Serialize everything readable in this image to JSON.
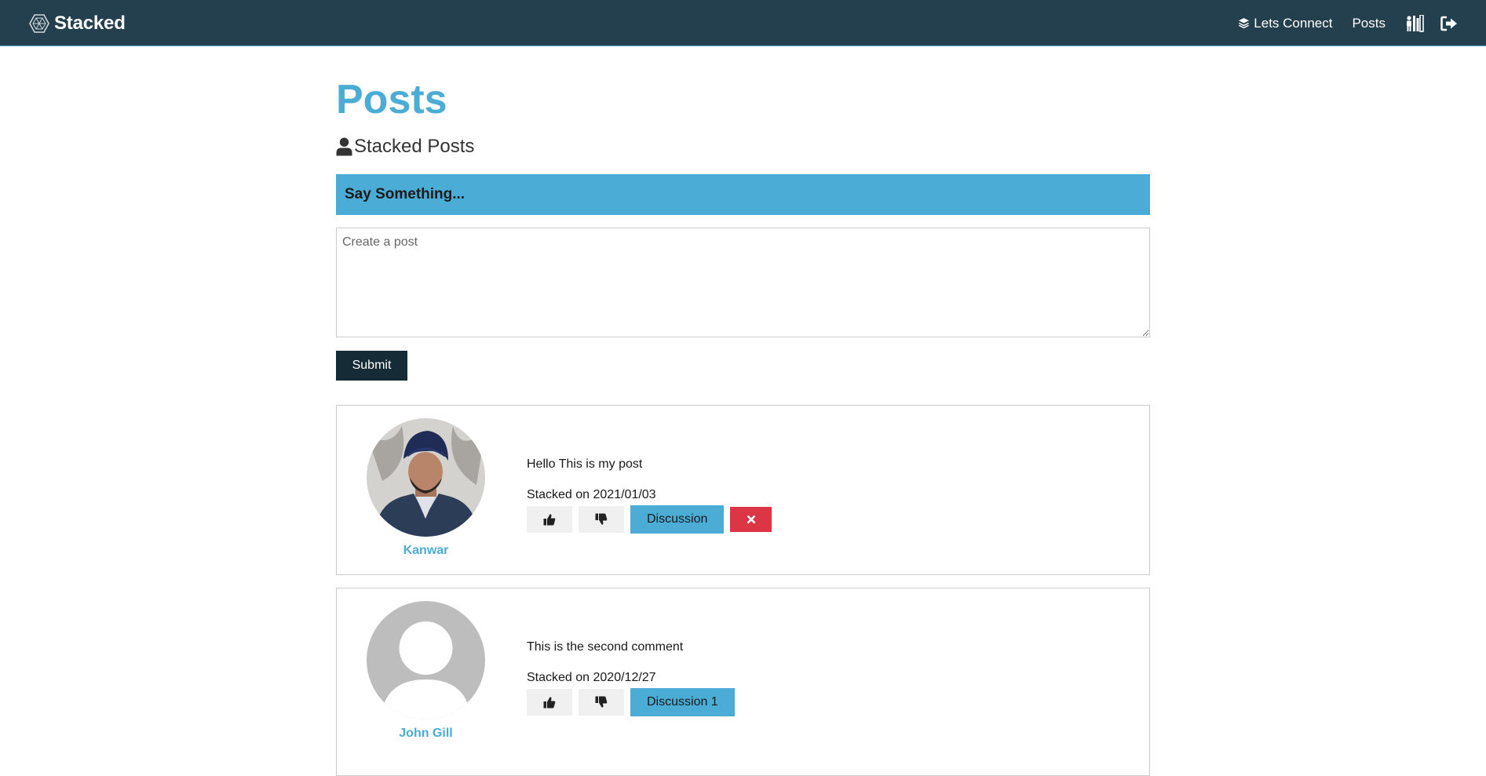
{
  "navbar": {
    "brand": "Stacked",
    "links": {
      "connect": "Lets Connect",
      "posts": "Posts"
    },
    "icons": {
      "brand": "hexagon-logo-icon",
      "connect": "layers-icon",
      "dashboard": "dashboard-icon",
      "logout": "sign-out-icon"
    },
    "color": "#243f4d"
  },
  "page": {
    "title": "Posts",
    "subtitle": "Stacked Posts",
    "subtitle_icon": "user-icon",
    "form_header": "Say Something...",
    "textarea_placeholder": "Create a post",
    "submit_label": "Submit"
  },
  "posts": [
    {
      "author": "Kanwar",
      "text": "Hello This is my post",
      "date": "Stacked on 2021/01/03",
      "discussion_label": "Discussion",
      "avatar": "user-photo",
      "show_delete": true
    },
    {
      "author": "John Gill",
      "text": "This is the second comment",
      "date": "Stacked on 2020/12/27",
      "discussion_label": "Discussion 1",
      "avatar": "default-avatar",
      "show_delete": false
    }
  ],
  "colors": {
    "accent": "#4badd6",
    "danger": "#dc3545",
    "dark": "#152b36"
  }
}
